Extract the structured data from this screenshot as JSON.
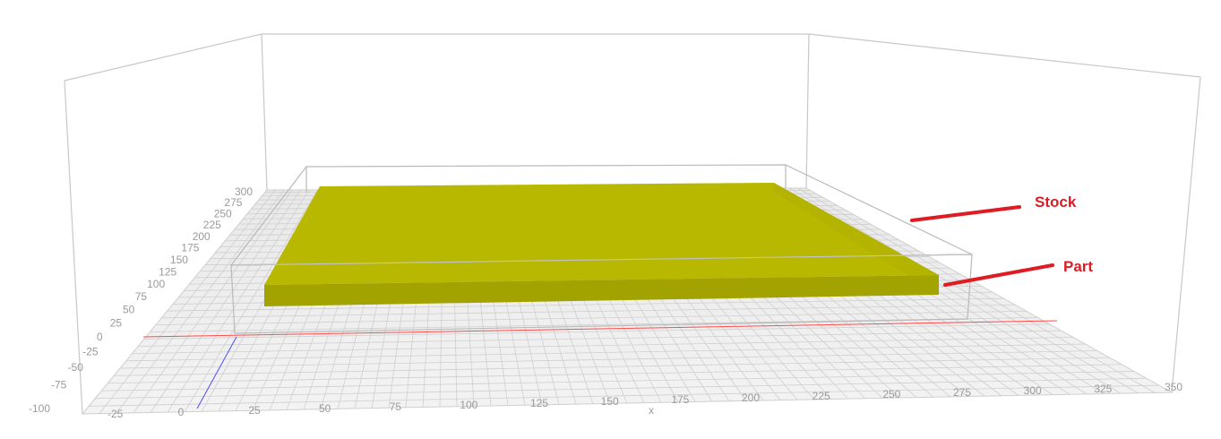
{
  "viewer": {
    "x_axis": {
      "label": "x",
      "ticks": [
        "-25",
        "0",
        "25",
        "50",
        "75",
        "100",
        "125",
        "150",
        "175",
        "200",
        "225",
        "250",
        "275",
        "300",
        "325",
        "350"
      ]
    },
    "y_axis": {
      "ticks": [
        "-100",
        "-75",
        "-50",
        "-25",
        "0",
        "25",
        "50",
        "75",
        "100",
        "125",
        "150",
        "175",
        "200",
        "225",
        "250",
        "275",
        "300"
      ]
    },
    "annotations": [
      {
        "label": "Stock",
        "color": "#dd1c24"
      },
      {
        "label": "Part",
        "color": "#dd1c24"
      }
    ],
    "colors": {
      "part_top": "#b8b800",
      "part_front": "#a2a200",
      "stock_outline": "#b9b9b9",
      "grid": "#cfcfcf",
      "x_axis_line": "#ff3b3b",
      "y_axis_line": "#3b3bff",
      "annotation": "#dd1c24"
    }
  }
}
